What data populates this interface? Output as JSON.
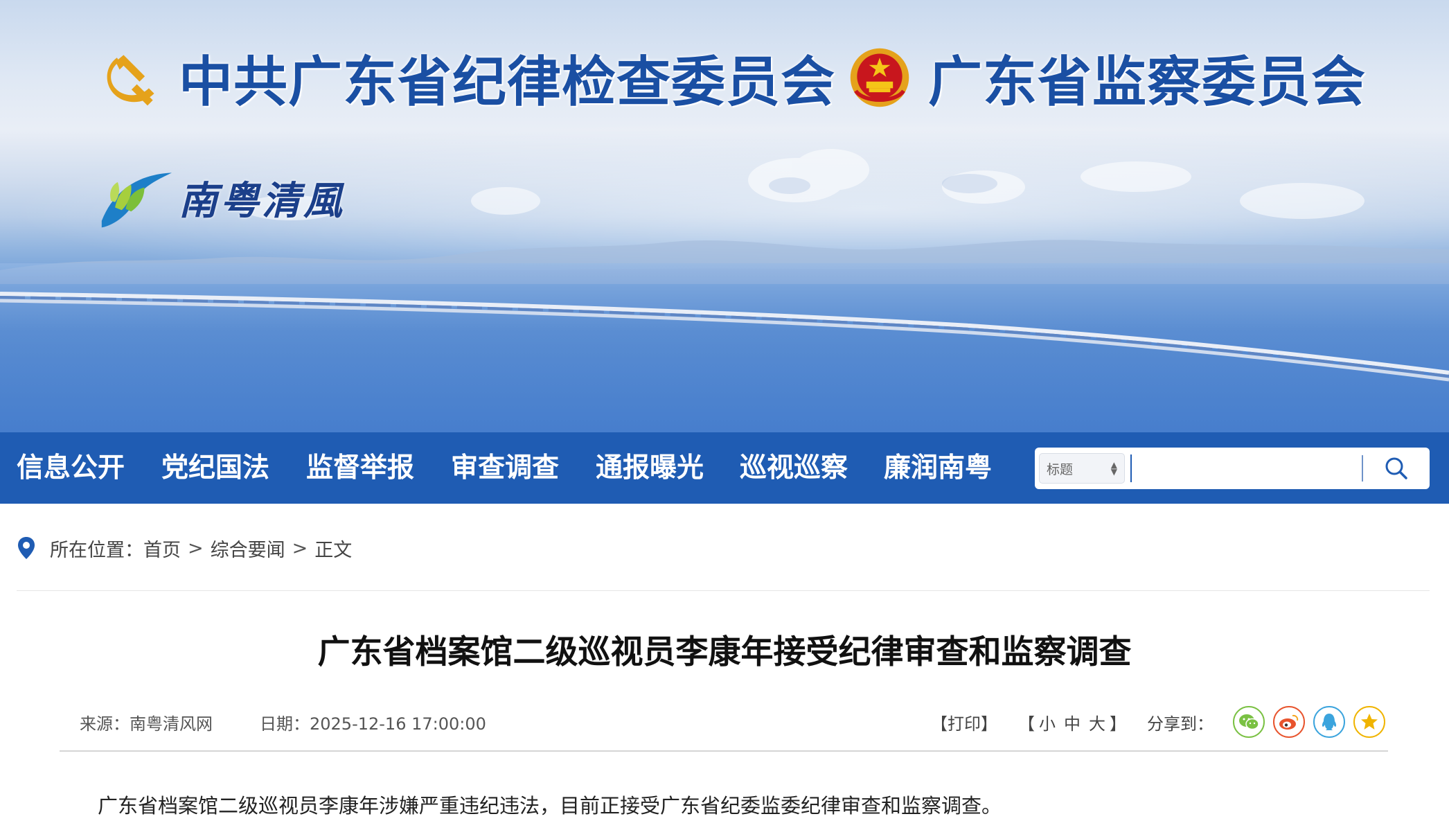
{
  "header": {
    "left_title": "中共广东省纪律检查委员会",
    "right_title": "广东省监察委员会",
    "slogan": "南粤清風",
    "left_emblem_icon": "party-emblem-icon",
    "right_emblem_icon": "national-emblem-icon",
    "slogan_logo_icon": "lotus-logo-icon",
    "colors": {
      "title": "#1a4fa3",
      "nav_bg": "#1f5cb3"
    }
  },
  "nav": {
    "items": [
      {
        "label": "信息公开"
      },
      {
        "label": "党纪国法"
      },
      {
        "label": "监督举报"
      },
      {
        "label": "审查调查"
      },
      {
        "label": "通报曝光"
      },
      {
        "label": "巡视巡察"
      },
      {
        "label": "廉润南粤"
      }
    ]
  },
  "search": {
    "scope_selected": "标题",
    "value": "",
    "icon": "search-icon"
  },
  "breadcrumb": {
    "label": "所在位置：",
    "items": [
      "首页",
      "综合要闻",
      "正文"
    ],
    "separator": ">",
    "icon": "location-pin-icon"
  },
  "article": {
    "title": "广东省档案馆二级巡视员李康年接受纪律审查和监察调查",
    "source": "来源：南粤清风网",
    "date": "日期：2025-12-16 17:00:00",
    "body": "广东省档案馆二级巡视员李康年涉嫌严重违纪违法，目前正接受广东省纪委监委纪律审查和监察调查。"
  },
  "tools": {
    "print": "【打印】",
    "size_open": "【",
    "size_small": "小",
    "size_medium": "中",
    "size_large": "大",
    "size_close": "】",
    "share_label": "分享到：",
    "share_icons": [
      "wechat-icon",
      "weibo-icon",
      "qq-icon",
      "qzone-icon"
    ],
    "share_colors": {
      "wechat": "#7ac143",
      "weibo": "#e8542d",
      "qq": "#3ba4dd",
      "qzone": "#f0b400"
    }
  }
}
